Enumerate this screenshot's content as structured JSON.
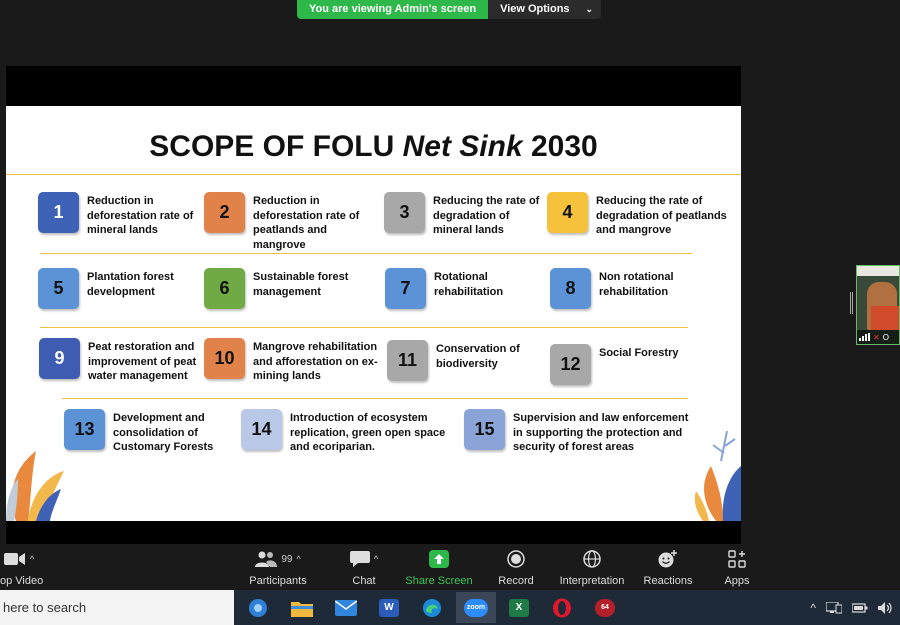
{
  "banner": {
    "viewing_text": "You are viewing Admin's screen",
    "view_options": "View Options",
    "chevron": "⌄"
  },
  "slide": {
    "title_part1": "SCOPE OF FOLU ",
    "title_italic": "Net Sink",
    "title_part2": " 2030",
    "items": [
      {
        "num": "1",
        "text": "Reduction in deforestation rate of mineral lands",
        "color": "#3e62b5"
      },
      {
        "num": "2",
        "text": "Reduction in deforestation rate of peatlands and mangrove",
        "color": "#e0824a"
      },
      {
        "num": "3",
        "text": "Reducing the rate of degradation of mineral lands",
        "color": "#a8a8a8"
      },
      {
        "num": "4",
        "text": "Reducing the rate of degradation of peatlands and mangrove",
        "color": "#f6c23c"
      },
      {
        "num": "5",
        "text": "Plantation forest development",
        "color": "#5b93d6"
      },
      {
        "num": "6",
        "text": "Sustainable forest management",
        "color": "#6faa45"
      },
      {
        "num": "7",
        "text": "Rotational rehabilitation",
        "color": "#5b93d6"
      },
      {
        "num": "8",
        "text": "Non rotational rehabilitation",
        "color": "#5b93d6"
      },
      {
        "num": "9",
        "text": "Peat restoration and improvement of peat water management",
        "color": "#3e5cb2"
      },
      {
        "num": "10",
        "text": "Mangrove rehabilitation and afforestation on ex-mining lands",
        "color": "#e0824a"
      },
      {
        "num": "11",
        "text": "Conservation of biodiversity",
        "color": "#a8a8a8"
      },
      {
        "num": "12",
        "text": "Social Forestry",
        "color": "#a8a8a8"
      },
      {
        "num": "13",
        "text": "Development and consolidation of Customary Forests",
        "color": "#5b93d6"
      },
      {
        "num": "14",
        "text": "Introduction of ecosystem replication, green open space and ecoriparian.",
        "color": "#b9c8e6"
      },
      {
        "num": "15",
        "text": "Supervision and law enforcement in supporting the protection and security of forest areas",
        "color": "#8aa4d8"
      }
    ]
  },
  "thumbnail": {
    "name_initial": "O"
  },
  "toolbar": {
    "stop_video": "op Video",
    "participants": "Participants",
    "participant_count": "99",
    "chat": "Chat",
    "share_screen": "Share Screen",
    "record": "Record",
    "interpretation": "Interpretation",
    "reactions": "Reactions",
    "apps": "Apps",
    "caret": "^"
  },
  "taskbar": {
    "search_text": "here to search",
    "apps": [
      "edge-copilot",
      "file-explorer",
      "mail",
      "word",
      "edge",
      "zoom",
      "excel",
      "opera",
      "game"
    ],
    "zoom_label": "zoom",
    "word_label": "W",
    "excel_label": "X",
    "game_badge": "64",
    "tray_caret": "^"
  },
  "colors": {
    "share_green": "#2eb84a",
    "slide_rule": "#f0c040"
  }
}
